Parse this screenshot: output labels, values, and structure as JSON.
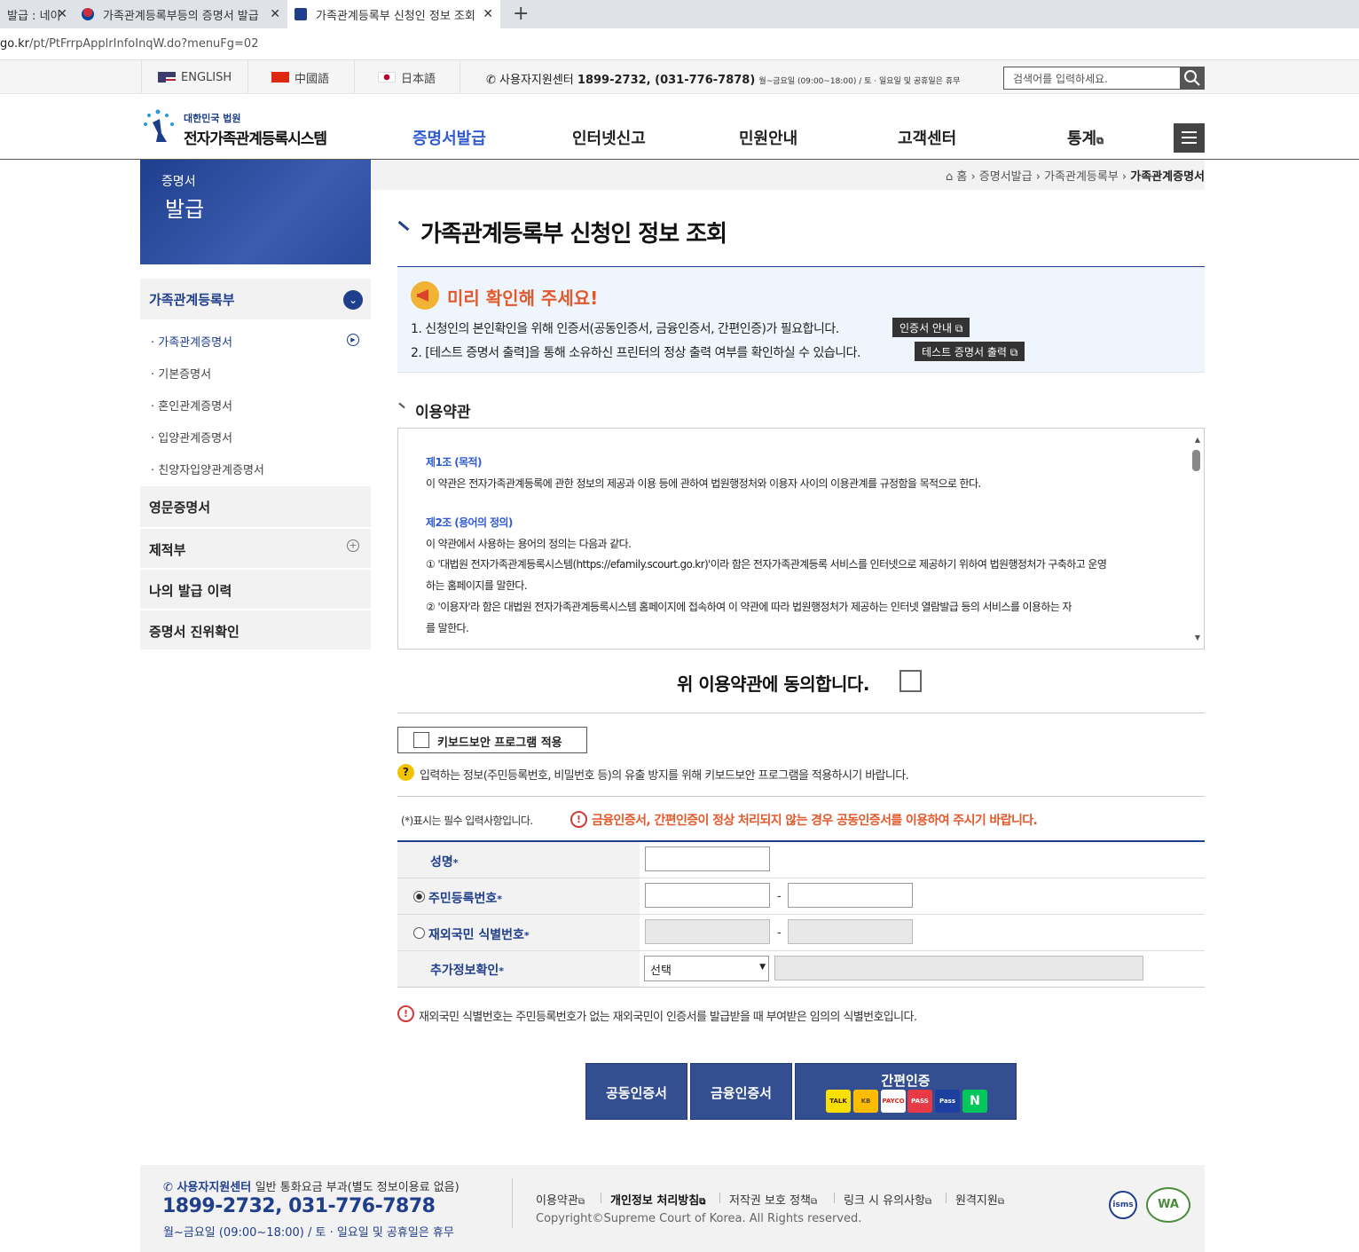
{
  "browser": {
    "tabs": [
      {
        "label": "발급 : 네이"
      },
      {
        "label": "가족관계등록부등의 증명서 발급"
      },
      {
        "label": "가족관계등록부 신청인 정보 조회"
      }
    ],
    "url_host": "go.kr",
    "url_path": "/pt/PtFrrpApplrInfoInqW.do?menuFg=02"
  },
  "util": {
    "languages": [
      "ENGLISH",
      "中國語",
      "日本語"
    ],
    "support_label": "사용자지원센터",
    "support_phone": "1899-2732, (031-776-7878)",
    "support_hours": "월~금요일 (09:00~18:00) / 토 · 일요일 및 공휴일은 휴무",
    "search_placeholder": "검색어를 입력하세요."
  },
  "header": {
    "logo_top": "대한민국 법원",
    "logo_main": "전자가족관계등록시스템",
    "gnb": [
      "증명서발급",
      "인터넷신고",
      "민원안내",
      "고객센터",
      "통계"
    ]
  },
  "lnb": {
    "hero_line1": "증명서",
    "hero_line2": "발급",
    "top1": "가족관계등록부",
    "subs": [
      "· 가족관계증명서",
      "· 기본증명서",
      "· 혼인관계증명서",
      "· 입양관계증명서",
      "· 친양자입양관계증명서"
    ],
    "top2": "영문증명서",
    "top3": "제적부",
    "top4": "나의 발급 이력",
    "top5": "증명서 진위확인"
  },
  "breadcrumb": {
    "home": "홈",
    "c1": "증명서발급",
    "c2": "가족관계등록부",
    "c3": "가족관계증명서"
  },
  "page_title": "가족관계등록부 신청인 정보 조회",
  "notice": {
    "title": "미리 확인해 주세요!",
    "line1": "1. 신청인의 본인확인을 위해 인증서(공동인증서, 금융인증서, 간편인증)가 필요합니다.",
    "btn1": "인증서 안내",
    "line2": "2. [테스트 증명서 출력]을 통해 소유하신 프린터의 정상 출력 여부를 확인하실 수 있습니다.",
    "btn2": "테스트 증명서 출력"
  },
  "terms": {
    "heading": "이용약관",
    "a1_title": "제1조 (목적)",
    "a1_body": "이 약관은 전자가족관계등록에 관한 정보의 제공과 이용 등에 관하여 법원행정처와 이용자 사이의 이용관계를 규정함을 목적으로 한다.",
    "a2_title": "제2조 (용어의 정의)",
    "a2_body": "이 약관에서 사용하는 용어의 정의는 다음과 같다.",
    "a2_l1": "① '대법원 전자가족관계등록시스템(https://efamily.scourt.go.kr)'이라 함은 전자가족관계등록 서비스를 인터넷으로 제공하기 위하여 법원행정처가 구축하고 운영",
    "a2_l1b": "하는 홈페이지를 말한다.",
    "a2_l2": "② '이용자'라 함은 대법원 전자가족관계등록시스템 홈페이지에 접속하여 이 약관에 따라 법원행정처가 제공하는 인터넷 열람발급 등의 서비스를 이용하는 자",
    "a2_l2b": "를 말한다.",
    "agree": "위 이용약관에 동의합니다."
  },
  "keyboard": {
    "btn": "키보드보안 프로그램 적용",
    "help": "입력하는 정보(주민등록번호, 비밀번호 등)의 유출 방지를 위해 키보드보안 프로그램을 적용하시기 바랍니다."
  },
  "form": {
    "required_note": "(*)표시는 필수 입력사항입니다.",
    "warn": "금융인증서, 간편인증이 정상 처리되지 않는 경우 공동인증서를 이용하여 주시기 바랍니다.",
    "name_label": "성명",
    "rrn_label": "주민등록번호",
    "foreign_label": "재외국민 식별번호",
    "extra_label": "추가정보확인",
    "select_value": "선택",
    "dash": "-",
    "star": "*",
    "foreign_note": "재외국민 식별번호는 주민등록번호가 없는 재외국민이 인증서를 발급받을 때 부여받은 임의의 식별번호입니다."
  },
  "cert": {
    "joint": "공동인증서",
    "financial": "금융인증서",
    "simple": "간편인증",
    "pay_icons": [
      "TALK",
      "KB",
      "PAYCO",
      "PASS",
      "Pass",
      "N"
    ]
  },
  "footer": {
    "support_label": "사용자지원센터",
    "support_note": "일반 통화요금 부과(별도 정보이용료 없음)",
    "phone": "1899-2732, 031-776-7878",
    "hours": "월~금요일 (09:00~18:00) / 토 · 일요일 및 공휴일은 휴무",
    "links": [
      "이용약관",
      "개인정보 처리방침",
      "저작권 보호 정책",
      "링크 시 유의사항",
      "원격지원"
    ],
    "copyright": "Copyright©Supreme Court of Korea. All Rights reserved.",
    "seal1": "isms",
    "seal2": "WA"
  },
  "colors": {
    "brand_blue": "#1f3e8c",
    "gnb_active": "#2f5bd3",
    "notice_title": "#e2592b",
    "cert_button": "#334f92"
  }
}
